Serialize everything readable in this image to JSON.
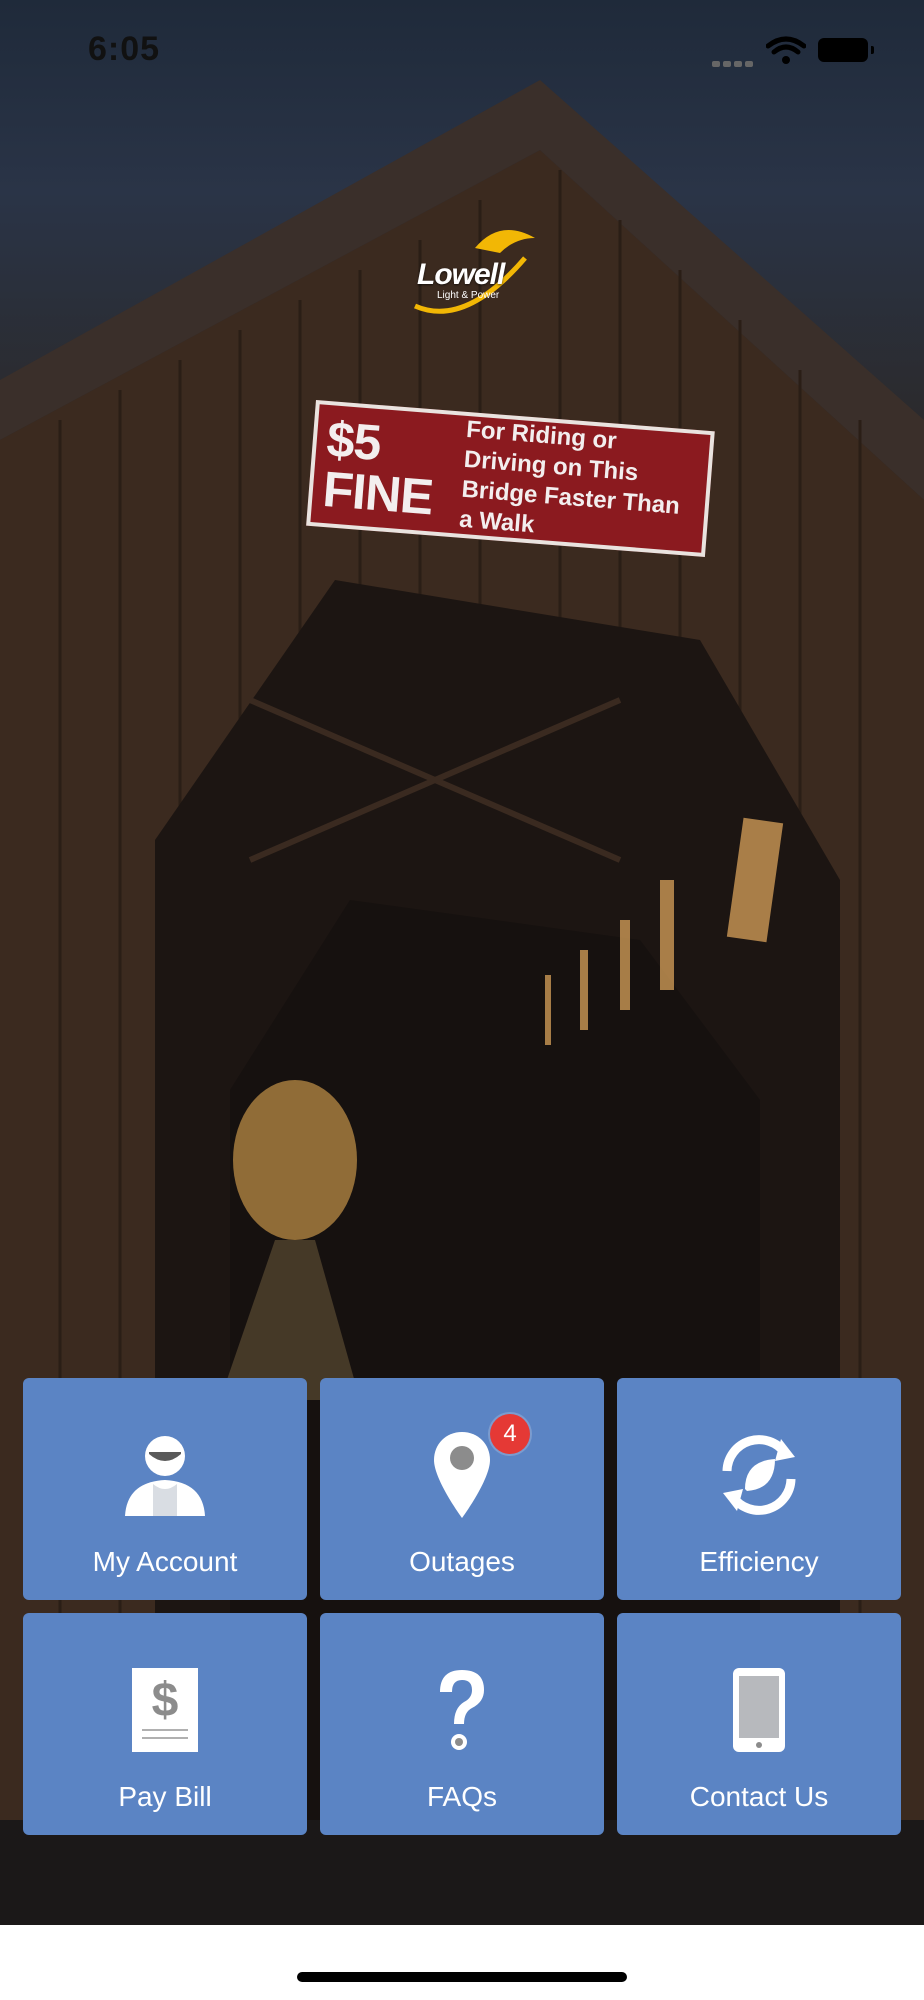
{
  "status_bar": {
    "time": "6:05"
  },
  "logo": {
    "name": "Lowell",
    "tagline": "Light & Power"
  },
  "sign": {
    "fine": "$5 FINE",
    "line1": "For Riding or Driving on This",
    "line2": "Bridge Faster Than a Walk"
  },
  "tiles": [
    {
      "label": "My Account",
      "icon": "account-icon"
    },
    {
      "label": "Outages",
      "icon": "location-pin-icon",
      "badge": "4"
    },
    {
      "label": "Efficiency",
      "icon": "leaf-refresh-icon"
    },
    {
      "label": "Pay Bill",
      "icon": "bill-icon"
    },
    {
      "label": "FAQs",
      "icon": "question-icon"
    },
    {
      "label": "Contact Us",
      "icon": "phone-icon"
    }
  ],
  "colors": {
    "tile": "#5b84c4",
    "badge": "#e53935",
    "sign": "#8b1a1f"
  }
}
